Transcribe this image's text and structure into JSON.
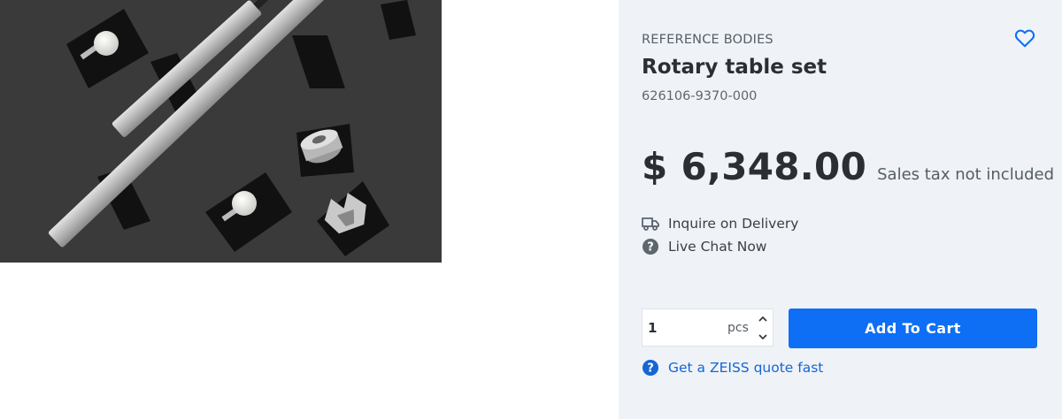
{
  "product": {
    "category": "REFERENCE BODIES",
    "title": "Rotary table set",
    "sku": "626106-9370-000",
    "image_icon": "product-photo",
    "wishlist_icon": "heart-outline-icon"
  },
  "pricing": {
    "price": "$ 6,348.00",
    "tax_note": "Sales tax not included"
  },
  "info": {
    "delivery": {
      "icon": "truck-icon",
      "label": "Inquire on Delivery"
    },
    "chat": {
      "icon": "question-circle-icon",
      "label": "Live Chat Now"
    }
  },
  "purchase": {
    "quantity": "1",
    "unit": "pcs",
    "add_to_cart_label": "Add To Cart"
  },
  "quote": {
    "icon": "question-circle-icon",
    "label": "Get a ZEISS quote fast"
  },
  "colors": {
    "panel_bg": "#eff3f7",
    "accent": "#0e6ff5",
    "link": "#1565d6",
    "text_dark": "#2b2f34"
  }
}
